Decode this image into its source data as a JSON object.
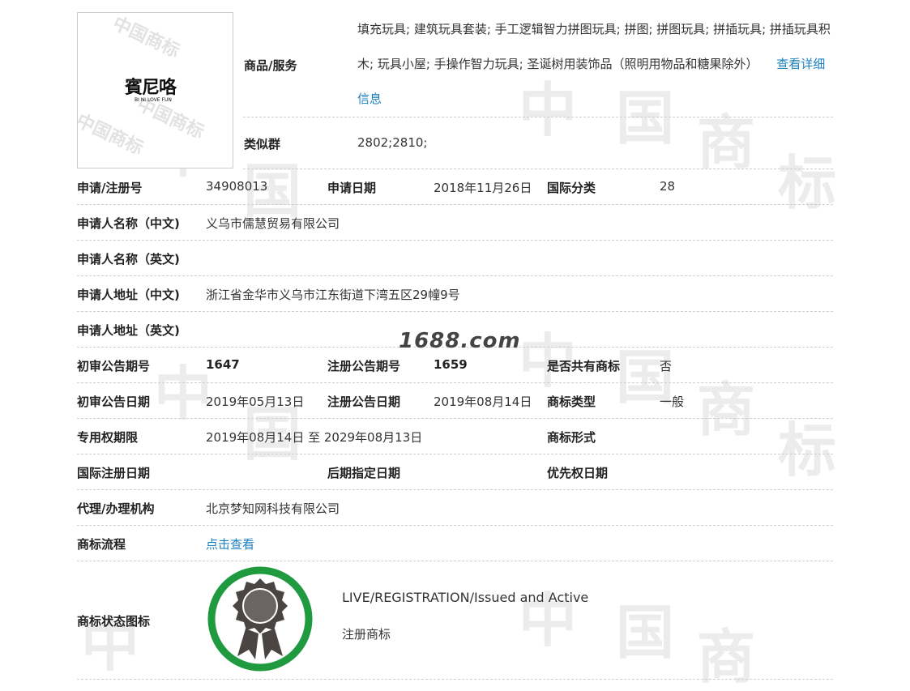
{
  "logo": {
    "text": "賓尼咯",
    "subtext": "BI NI LOVE FUN"
  },
  "goods": {
    "label": "商品/服务",
    "text": "填充玩具; 建筑玩具套装; 手工逻辑智力拼图玩具; 拼图; 拼图玩具; 拼插玩具; 拼插玩具积木; 玩具小屋; 手操作智力玩具; 圣诞树用装饰品（照明用物品和糖果除外）",
    "link": "查看详细信息"
  },
  "similar": {
    "label": "类似群",
    "value": "2802;2810;"
  },
  "reg": {
    "label": "申请/注册号",
    "value": "34908013",
    "date_label": "申请日期",
    "date": "2018年11月26日",
    "intl_label": "国际分类",
    "intl": "28"
  },
  "applicant_cn": {
    "label": "申请人名称（中文)",
    "value": "义乌市儒慧贸易有限公司"
  },
  "applicant_en": {
    "label": "申请人名称（英文)",
    "value": ""
  },
  "address_cn": {
    "label": "申请人地址（中文)",
    "value": "浙江省金华市义乌市江东街道下湾五区29幢9号"
  },
  "address_en": {
    "label": "申请人地址（英文)",
    "value": ""
  },
  "prelim_no": {
    "label": "初审公告期号",
    "value": "1647",
    "reg_label": "注册公告期号",
    "reg_value": "1659",
    "shared_label": "是否共有商标",
    "shared_value": "否"
  },
  "prelim_date": {
    "label": "初审公告日期",
    "value": "2019年05月13日",
    "reg_label": "注册公告日期",
    "reg_value": "2019年08月14日",
    "type_label": "商标类型",
    "type_value": "一般"
  },
  "term": {
    "label": "专用权期限",
    "value": "2019年08月14日 至 2029年08月13日",
    "form_label": "商标形式",
    "form_value": ""
  },
  "intl_reg": {
    "label": "国际注册日期",
    "later_label": "后期指定日期",
    "priority_label": "优先权日期"
  },
  "agent": {
    "label": "代理/办理机构",
    "value": "北京梦知网科技有限公司"
  },
  "flow": {
    "label": "商标流程",
    "link": "点击查看"
  },
  "status": {
    "label": "商标状态图标",
    "en": "LIVE/REGISTRATION/Issued and Active",
    "cn": "注册商标"
  },
  "watermark": {
    "site": "1688.com",
    "text": "中国商标"
  },
  "colors": {
    "link": "#1a7fc1",
    "seal_ring": "#1f9a3f",
    "seal_body": "#4a4443"
  }
}
